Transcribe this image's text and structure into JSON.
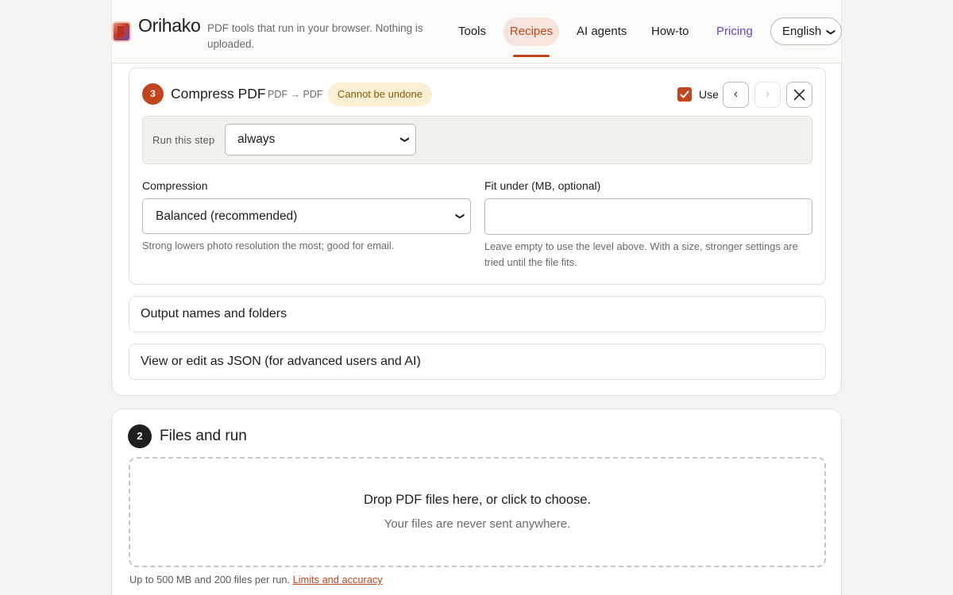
{
  "header": {
    "brand": "Orihako",
    "tagline": "PDF tools that run in your browser. Nothing is uploaded.",
    "nav": [
      "Tools",
      "Recipes",
      "AI agents",
      "How-to",
      "Pricing"
    ],
    "active_nav": "Recipes",
    "language": "English"
  },
  "step": {
    "number": "3",
    "title": "Compress PDF",
    "type": "PDF → PDF",
    "badge": "Cannot be undone",
    "use_label": "Use",
    "use_checked": true,
    "prev_glyph": "‹",
    "next_glyph": "›",
    "close_glyph": "✕",
    "run_label": "Run this step",
    "run_value": "always",
    "compression_label": "Compression",
    "compression_value": "Balanced (recommended)",
    "compression_hint": "Strong lowers photo resolution the most; good for email.",
    "fit_label": "Fit under (MB, optional)",
    "fit_value": "",
    "fit_hint": "Leave empty to use the level above. With a size, stronger settings are tried until the file fits."
  },
  "sections": {
    "output_names": "Output names and folders",
    "json_edit": "View or edit as JSON (for advanced users and AI)"
  },
  "files": {
    "number": "2",
    "title": "Files and run",
    "drop_main": "Drop PDF files here, or click to choose.",
    "drop_sub": "Your files are never sent anywhere.",
    "limits_text": "Up to 500 MB and 200 files per run.",
    "limits_link": "Limits and accuracy"
  },
  "colors": {
    "accent": "#c2451e",
    "pricing": "#6a44c9",
    "badge_bg": "#fbf0d4",
    "badge_text": "#8a5a0a"
  },
  "icons": {
    "logo": "orihako-logo-icon",
    "chevron": "chevron-down-icon",
    "check": "check-icon",
    "prev": "chevron-left-icon",
    "next": "chevron-right-icon",
    "close": "close-icon"
  }
}
